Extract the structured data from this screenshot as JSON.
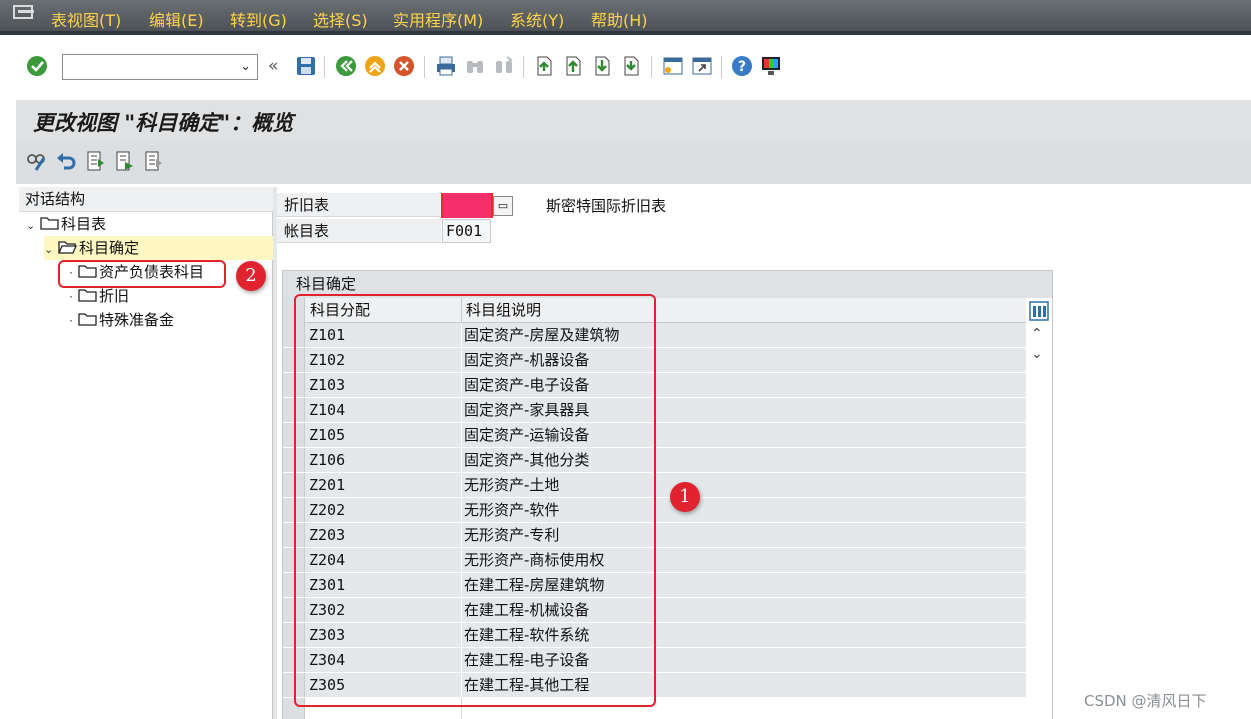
{
  "menu": {
    "items": [
      "表视图(T)",
      "编辑(E)",
      "转到(G)",
      "选择(S)",
      "实用程序(M)",
      "系统(Y)",
      "帮助(H)"
    ]
  },
  "toolbar": {
    "command_value": "",
    "icons": [
      "enter-icon",
      "back-icon",
      "save-icon",
      "back-green-icon",
      "exit-icon",
      "cancel-icon",
      "print-icon",
      "find-icon",
      "find-next-icon",
      "first-page-icon",
      "prev-page-icon",
      "next-page-icon",
      "last-page-icon",
      "new-session-icon",
      "shortcut-icon",
      "help-icon",
      "customize-layout-icon"
    ]
  },
  "title": "更改视图 \"科目确定\"：概览",
  "tree": {
    "header": "对话结构",
    "nodes": [
      {
        "label": "科目表",
        "level": 0,
        "expanded": true
      },
      {
        "label": "科目确定",
        "level": 1,
        "expanded": true,
        "highlighted": true
      },
      {
        "label": "资产负债表科目",
        "level": 2
      },
      {
        "label": "折旧",
        "level": 2
      },
      {
        "label": "特殊准备金",
        "level": 2
      }
    ]
  },
  "fields": {
    "depreciation_key_label": "折旧表",
    "depreciation_key_value": "",
    "depreciation_key_desc": "斯密特国际折旧表",
    "chart_of_accounts_label": "帐目表",
    "chart_of_accounts_value": "F001"
  },
  "table": {
    "title": "科目确定",
    "columns": [
      "科目分配",
      "科目组说明"
    ],
    "rows": [
      [
        "Z101",
        "固定资产-房屋及建筑物"
      ],
      [
        "Z102",
        "固定资产-机器设备"
      ],
      [
        "Z103",
        "固定资产-电子设备"
      ],
      [
        "Z104",
        "固定资产-家具器具"
      ],
      [
        "Z105",
        "固定资产-运输设备"
      ],
      [
        "Z106",
        "固定资产-其他分类"
      ],
      [
        "Z201",
        "无形资产-土地"
      ],
      [
        "Z202",
        "无形资产-软件"
      ],
      [
        "Z203",
        "无形资产-专利"
      ],
      [
        "Z204",
        "无形资产-商标使用权"
      ],
      [
        "Z301",
        "在建工程-房屋建筑物"
      ],
      [
        "Z302",
        "在建工程-机械设备"
      ],
      [
        "Z303",
        "在建工程-软件系统"
      ],
      [
        "Z304",
        "在建工程-电子设备"
      ],
      [
        "Z305",
        "在建工程-其他工程"
      ]
    ]
  },
  "annotations": {
    "badge1": "1",
    "badge2": "2"
  },
  "watermark": "CSDN @清风日下",
  "colors": {
    "menu_text": "#ffd24a",
    "annotation": "#e0232f",
    "redaction": "#f5306a"
  }
}
